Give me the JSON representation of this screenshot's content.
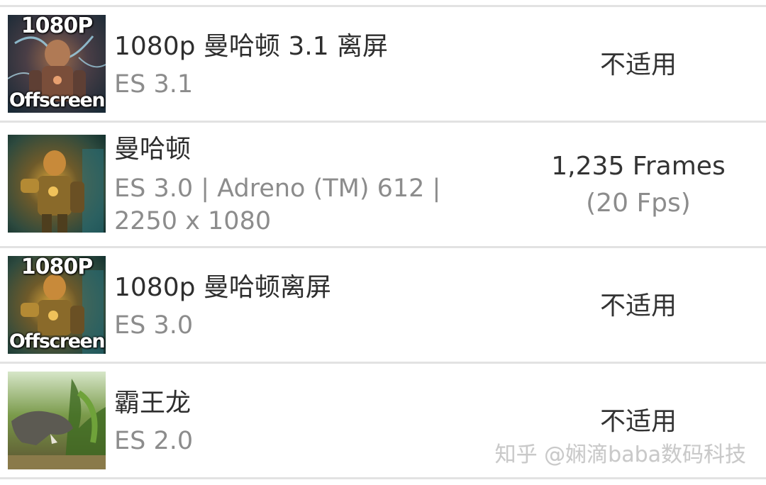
{
  "tests": [
    {
      "title": "1080p 曼哈顿 3.1 离屏",
      "subtitle": "ES 3.1",
      "result": "不适用",
      "result_detail": "",
      "thumbnail": {
        "badge_top": "1080P",
        "badge_bottom": "Offscreen",
        "icon": "manhattan-robot-thumbnail"
      }
    },
    {
      "title": "曼哈顿",
      "subtitle": "ES 3.0 | Adreno (TM) 612 | 2250 x 1080",
      "result": "1,235 Frames",
      "result_detail": "(20 Fps)",
      "thumbnail": {
        "badge_top": "",
        "badge_bottom": "",
        "icon": "manhattan-robot-thumbnail"
      }
    },
    {
      "title": "1080p 曼哈顿离屏",
      "subtitle": "ES 3.0",
      "result": "不适用",
      "result_detail": "",
      "thumbnail": {
        "badge_top": "1080P",
        "badge_bottom": "Offscreen",
        "icon": "manhattan-robot-thumbnail"
      }
    },
    {
      "title": "霸王龙",
      "subtitle": "ES 2.0",
      "result": "不适用",
      "result_detail": "",
      "thumbnail": {
        "badge_top": "",
        "badge_bottom": "",
        "icon": "t-rex-thumbnail"
      }
    }
  ],
  "watermark": "知乎 @娴滴baba数码科技",
  "colors": {
    "divider": "#e2e2e2",
    "title": "#2e2e2e",
    "subtitle": "#8c8c8c",
    "result": "#333333"
  }
}
